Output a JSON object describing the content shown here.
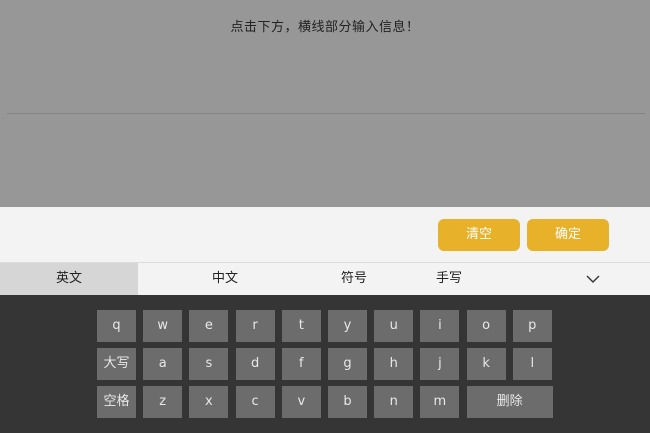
{
  "prompt": "点击下方，横线部分输入信息！",
  "actions": {
    "clear_label": "清空",
    "confirm_label": "确定"
  },
  "tabs": {
    "english": "英文",
    "chinese": "中文",
    "symbols": "符号",
    "handwriting": "手写",
    "collapse_icon": "chevron-down-icon"
  },
  "keyboard": {
    "row1": [
      "q",
      "w",
      "e",
      "r",
      "t",
      "y",
      "u",
      "i",
      "o",
      "p"
    ],
    "row2": [
      "大写",
      "a",
      "s",
      "d",
      "f",
      "g",
      "h",
      "j",
      "k",
      "l"
    ],
    "row3": [
      "空格",
      "z",
      "x",
      "c",
      "v",
      "b",
      "n",
      "m",
      "删除"
    ]
  },
  "colors": {
    "accent": "#e7b12a",
    "key_bg": "#6c6c6c",
    "keyboard_bg": "#353535",
    "overlay_bg": "#979797"
  }
}
